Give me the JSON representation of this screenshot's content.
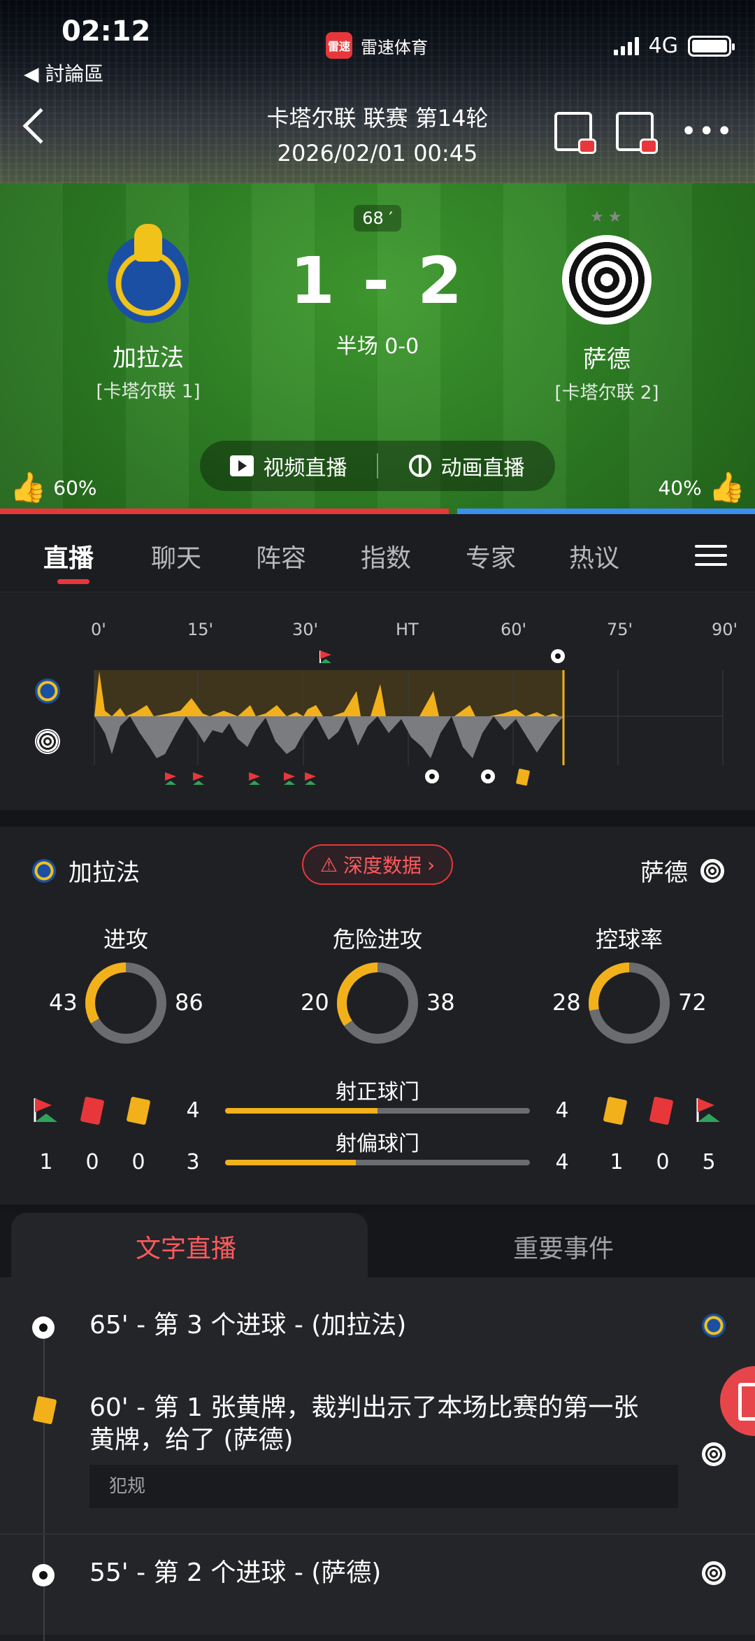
{
  "status_bar": {
    "time": "02:12",
    "back_label": "◀ 討論區",
    "app_logo_text": "雷速",
    "app_name": "雷速体育",
    "network": "4G"
  },
  "header": {
    "title": "卡塔尔联 联赛 第14轮",
    "datetime": "2026/02/01 00:45"
  },
  "match": {
    "minute": "68 ′",
    "score": "1 - 2",
    "half_score": "半场 0-0",
    "home": {
      "name": "加拉法",
      "league_rank": "[卡塔尔联 1]"
    },
    "away": {
      "name": "萨德",
      "league_rank": "[卡塔尔联 2]"
    },
    "video_label": "视频直播",
    "animation_label": "动画直播",
    "home_vote": "60%",
    "away_vote": "40%",
    "home_vote_fraction": 0.6
  },
  "tabs": [
    "直播",
    "聊天",
    "阵容",
    "指数",
    "专家",
    "热议"
  ],
  "timeline": {
    "ticks": [
      "0'",
      "15'",
      "30'",
      "HT",
      "60'",
      "75'",
      "90'"
    ],
    "current_minute": 68
  },
  "stats": {
    "home_name": "加拉法",
    "away_name": "萨德",
    "deep_data_label": "深度数据",
    "rings": [
      {
        "label": "进攻",
        "home": "43",
        "away": "86",
        "home_fraction": 0.333
      },
      {
        "label": "危险进攻",
        "home": "20",
        "away": "38",
        "home_fraction": 0.345
      },
      {
        "label": "控球率",
        "home": "28",
        "away": "72",
        "home_fraction": 0.28
      }
    ],
    "shots_on_label": "射正球门",
    "shots_off_label": "射偏球门",
    "home_shots_on": "4",
    "away_shots_on": "4",
    "home_shots_off": "3",
    "away_shots_off": "4",
    "shots_on_home_fraction": 0.5,
    "shots_off_home_fraction": 0.43,
    "home_corners": "1",
    "home_red": "0",
    "home_yellow": "0",
    "away_yellow": "1",
    "away_red": "0",
    "away_corners": "5"
  },
  "feed_tabs": {
    "active": "文字直播",
    "other": "重要事件"
  },
  "feed": [
    {
      "text": "65' - 第 3 个进球 - (加拉法)"
    },
    {
      "text_line1": "60' - 第 1 张黄牌，裁判出示了本场比赛的第一张",
      "text_line2": "黄牌，给了 (萨德)",
      "note": "犯规"
    },
    {
      "text": "55' - 第 2 个进球 - (萨德)"
    }
  ],
  "colors": {
    "accent": "#e8373b",
    "yellow": "#f2b11b",
    "away_blue": "#3b8ff0",
    "ring_grey": "#6b6c70"
  }
}
